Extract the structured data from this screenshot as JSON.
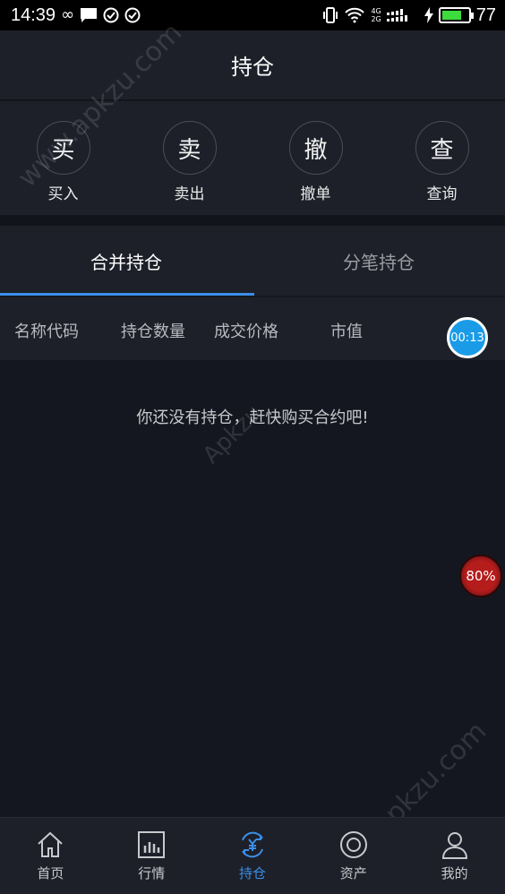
{
  "status_bar": {
    "time": "14:39",
    "infinity_glyph": "∞",
    "network_tag_top": "4G",
    "network_tag_bottom": "2G",
    "battery_percent": "77",
    "battery_level": 0.77,
    "battery_color": "#3ddc3d"
  },
  "header": {
    "title": "持仓"
  },
  "actions": [
    {
      "glyph": "买",
      "label": "买入"
    },
    {
      "glyph": "卖",
      "label": "卖出"
    },
    {
      "glyph": "撤",
      "label": "撤单"
    },
    {
      "glyph": "查",
      "label": "查询"
    }
  ],
  "tabs": [
    {
      "label": "合并持仓",
      "active": true
    },
    {
      "label": "分笔持仓",
      "active": false
    }
  ],
  "columns": [
    "名称代码",
    "持仓数量",
    "成交价格",
    "市值"
  ],
  "empty_message": "你还没有持仓，赶快购买合约吧!",
  "overlays": {
    "timer": "00:13",
    "percent": "80%"
  },
  "watermarks": [
    "www.apkzu.com",
    "Apkzu",
    "www.apkzu.com"
  ],
  "bottom_nav": [
    {
      "icon": "home-icon",
      "label": "首页",
      "active": false
    },
    {
      "icon": "chart-icon",
      "label": "行情",
      "active": false
    },
    {
      "icon": "yen-cycle-icon",
      "label": "持仓",
      "active": true
    },
    {
      "icon": "assets-icon",
      "label": "资产",
      "active": false
    },
    {
      "icon": "user-icon",
      "label": "我的",
      "active": false
    }
  ],
  "colors": {
    "accent": "#3b8ee8",
    "background": "#151720",
    "panel": "#1d2029"
  }
}
